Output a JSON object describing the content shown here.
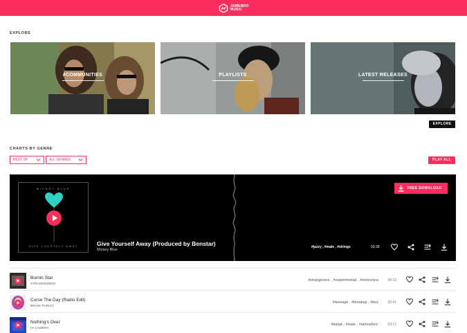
{
  "header": {
    "logo_line1": "JAMENDO",
    "logo_line2": "MUSIC",
    "brand_color": "#fd2e5e"
  },
  "explore": {
    "title": "EXPLORE",
    "tiles": [
      {
        "label": "#COMMUNITIES"
      },
      {
        "label": "PLAYLISTS"
      },
      {
        "label": "LATEST RELEASES"
      }
    ],
    "button_label": "EXPLORE"
  },
  "charts": {
    "title": "CHARTS BY GENRE",
    "period_select": "BEST OF",
    "genre_select": "ALL GENRES",
    "play_all_label": "PLAY ALL"
  },
  "featured": {
    "cover_top_text": "MICKEY BLUE",
    "cover_bottom_text": "GIVE YOURSELF AWAY",
    "title": "Give Yourself Away (Produced by Benstar)",
    "artist": "Mickey Blue",
    "tags": "#jazzy , #male , #strings",
    "duration": "03:39",
    "download_label": "FREE DOWNLOAD"
  },
  "tracks": [
    {
      "title": "Burnin Star",
      "artist": "STRANGEZERO",
      "tags": "#strangezero , #experimental , #eletronica",
      "duration": "06:16"
    },
    {
      "title": "Curse The Day (Radio Edit)",
      "artist": "BRAIN PURIST",
      "tags": "#teenage , #breakup , #boy",
      "duration": "03:41"
    },
    {
      "title": "Nothing's Over",
      "artist": "IN CAMERA",
      "tags": "#balad , #male , #atmosferic",
      "duration": "03:12"
    }
  ]
}
